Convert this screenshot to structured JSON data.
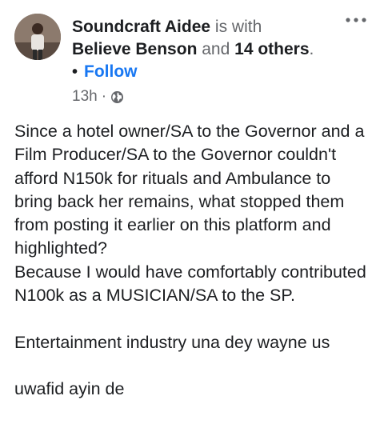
{
  "header": {
    "author": "Soundcraft Aidee",
    "with_text": "is with",
    "tagged": "Believe Benson",
    "and_text": "and",
    "others": "14 others",
    "period": ".",
    "bullet": "•",
    "follow_label": "Follow"
  },
  "meta": {
    "time": "13h",
    "separator": "·",
    "privacy_icon": "globe-icon"
  },
  "more_icon": "more-options-icon",
  "post": {
    "body": "Since a hotel owner/SA to the Governor and a Film Producer/SA to the Governor couldn't afford N150k for rituals and Ambulance to bring back her remains, what stopped them from posting it earlier on this platform and highlighted?\nBecause I would have comfortably contributed N100k as a MUSICIAN/SA to the SP.\n\nEntertainment industry una dey wayne us\n\n uwafid ayin de"
  },
  "colors": {
    "link": "#1877f2",
    "secondary_text": "#65676b",
    "primary_text": "#1c1e21"
  }
}
